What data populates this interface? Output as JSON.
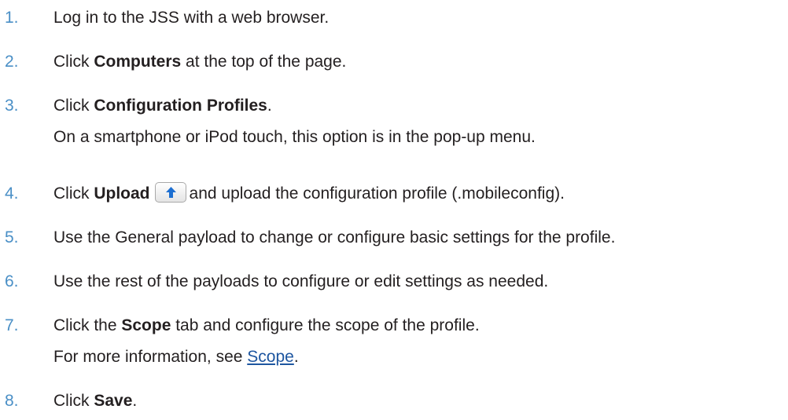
{
  "steps": [
    {
      "number": "1.",
      "before": "Log in to the JSS with a web browser."
    },
    {
      "number": "2.",
      "before": "Click ",
      "bold": "Computers",
      "after": " at the top of the page."
    },
    {
      "number": "3.",
      "before": "Click ",
      "bold": "Configuration Profiles",
      "after": ".",
      "note": "On a smartphone or iPod touch, this option is in the pop-up menu."
    },
    {
      "number": "4.",
      "before": "Click ",
      "bold": "Upload",
      "after": "and upload the configuration profile (.mobileconfig).",
      "icon": "upload-arrow-icon"
    },
    {
      "number": "5.",
      "before": "Use the General payload to change or configure basic settings for the profile."
    },
    {
      "number": "6.",
      "before": "Use the rest of the payloads to configure or edit settings as needed."
    },
    {
      "number": "7.",
      "before": "Click the ",
      "bold": "Scope",
      "after": " tab and configure the scope of the profile.",
      "note_before": "For more information, see ",
      "note_link": "Scope",
      "note_after": "."
    },
    {
      "number": "8.",
      "before": "Click ",
      "bold": "Save",
      "after": "."
    }
  ],
  "colors": {
    "step_number": "#4a8fc6",
    "text": "#231f20",
    "link": "#1e56a0",
    "icon_arrow": "#1d6fd1"
  }
}
